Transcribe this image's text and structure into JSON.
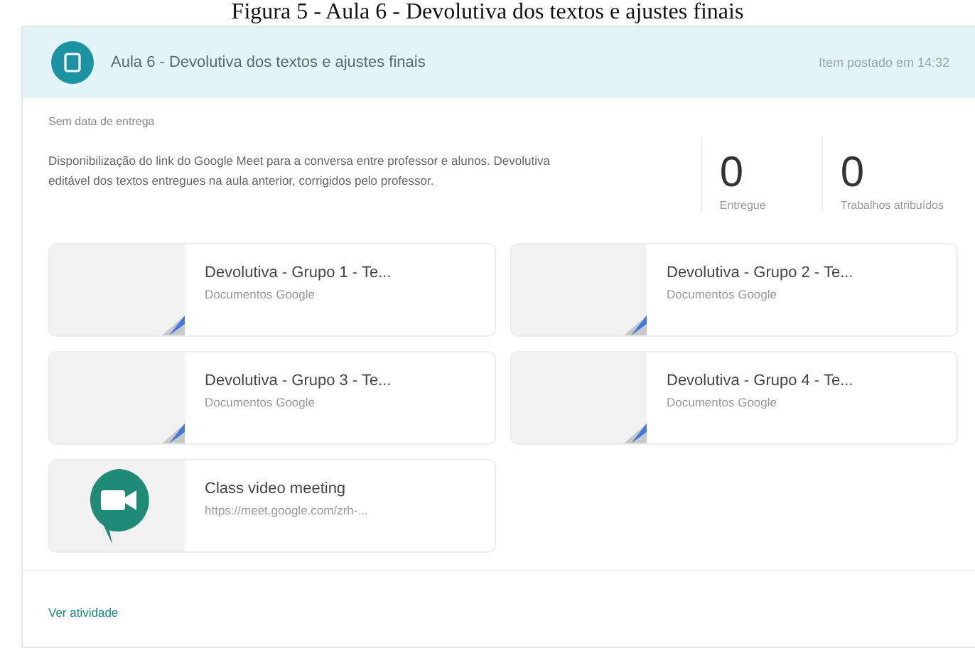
{
  "caption": "Figura 5 - Aula 6 - Devolutiva dos textos e ajustes finais",
  "header": {
    "title": "Aula 6 - Devolutiva dos textos e ajustes finais",
    "posted": "Item postado em 14:32"
  },
  "due": "Sem data de entrega",
  "description": "Disponibilização do link do Google Meet para a conversa entre professor e alunos. Devolutiva editável dos textos entregues na aula anterior, corrigidos pelo professor.",
  "stats": [
    {
      "value": "0",
      "label": "Entregue"
    },
    {
      "value": "0",
      "label": "Trabalhos atribuídos"
    }
  ],
  "attachments": [
    {
      "kind": "doc",
      "title": "Devolutiva - Grupo 1 - Te...",
      "subtitle": "Documentos Google"
    },
    {
      "kind": "doc",
      "title": "Devolutiva - Grupo 2 - Te...",
      "subtitle": "Documentos Google"
    },
    {
      "kind": "doc",
      "title": "Devolutiva - Grupo 3 - Te...",
      "subtitle": "Documentos Google"
    },
    {
      "kind": "doc",
      "title": "Devolutiva - Grupo 4 - Te...",
      "subtitle": "Documentos Google"
    },
    {
      "kind": "meet",
      "title": "Class video meeting",
      "subtitle": "https://meet.google.com/zrh-..."
    }
  ],
  "footer_link": "Ver atividade"
}
